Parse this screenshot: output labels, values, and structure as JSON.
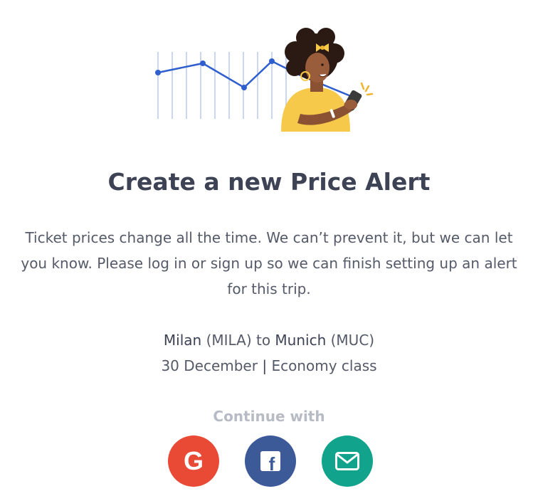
{
  "title": "Create a new Price Alert",
  "description": {
    "line1": "Ticket prices change all the time. We can’t prevent it, but we can let",
    "line2": "you know. Please log in or sign up so we can finish setting up an alert",
    "line3": "for this trip."
  },
  "trip": {
    "origin_city": "Milan",
    "origin_code": "(MILA)",
    "connector": "to",
    "destination_city": "Munich",
    "destination_code": "(MUC)",
    "date": "30 December",
    "separator": "|",
    "cabin_class": "Economy class"
  },
  "continue_label": "Continue with",
  "social_buttons": [
    {
      "provider": "google",
      "icon": "google-icon",
      "glyph": "G",
      "color": "#e84a35"
    },
    {
      "provider": "facebook",
      "icon": "facebook-icon",
      "glyph": "f",
      "color": "#3d5a98"
    },
    {
      "provider": "email",
      "icon": "email-icon",
      "color": "#12a38c"
    }
  ],
  "colors": {
    "title": "#3d4254",
    "body_text": "#555a68",
    "muted": "#b7bbc4",
    "chart_line": "#2f5fcf",
    "chart_grid": "#b9c9ee",
    "accent_yellow": "#f6c94a"
  }
}
